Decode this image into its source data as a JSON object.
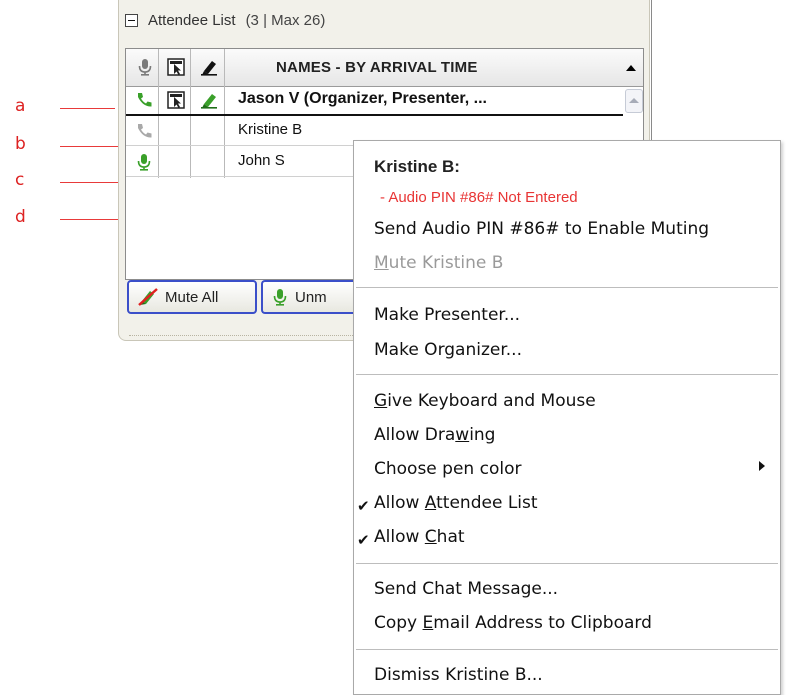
{
  "annotations": {
    "a": "a",
    "b": "b",
    "c": "c",
    "d": "d"
  },
  "panel": {
    "title": "Attendee List",
    "count": "(3 | Max 26)",
    "column_header": "NAMES - BY ARRIVAL TIME",
    "rows": [
      {
        "name": "Jason V (Organizer, Presenter, ...",
        "audio": "phone-active",
        "presenter": true,
        "drawing": true
      },
      {
        "name": "Kristine B",
        "audio": "phone-inactive",
        "presenter": false,
        "drawing": false
      },
      {
        "name": "John S",
        "audio": "mic-active",
        "presenter": false,
        "drawing": false
      }
    ],
    "mute_all_label": "Mute All",
    "unmute_all_label": "Unm"
  },
  "menu": {
    "header": "Kristine B:",
    "warning": "- Audio PIN #86# Not Entered",
    "items": {
      "send_pin": "Send Audio PIN #86# to Enable Muting",
      "mute": {
        "pre": "",
        "accel": "M",
        "post": "ute Kristine B"
      },
      "make_presenter": "Make Presenter...",
      "make_organizer": "Make Organizer...",
      "give_keyboard": {
        "pre": "",
        "accel": "G",
        "post": "ive Keyboard and Mouse"
      },
      "allow_drawing": {
        "pre": "Allow Dra",
        "accel": "w",
        "post": "ing"
      },
      "choose_pen": "Choose pen color",
      "allow_attendee": {
        "pre": "Allow ",
        "accel": "A",
        "post": "ttendee List"
      },
      "allow_chat": {
        "pre": "Allow ",
        "accel": "C",
        "post": "hat"
      },
      "send_chat": "Send Chat Message...",
      "copy_email": {
        "pre": "Copy ",
        "accel": "E",
        "post": "mail Address to Clipboard"
      },
      "dismiss": "Dismiss Kristine B..."
    },
    "check_glyph": "✔"
  },
  "colors": {
    "annotation": "#e83a3a",
    "warning": "#e83434",
    "button_border": "#3b4fc9",
    "green": "#3aa02a"
  }
}
